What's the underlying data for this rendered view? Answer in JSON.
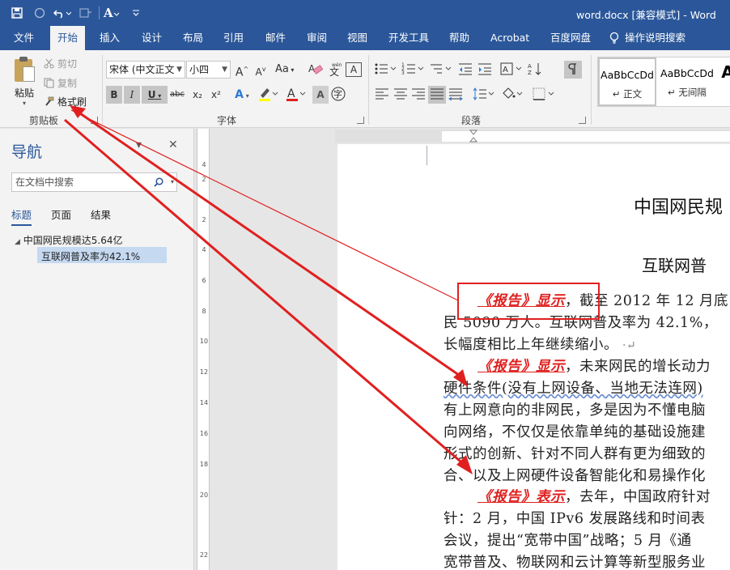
{
  "window": {
    "title": "word.docx [兼容模式] - Word"
  },
  "quick_access": {
    "icons": [
      "save-icon",
      "autosave-icon",
      "undo-icon",
      "redo-icon",
      "font-icon",
      "customize-icon"
    ]
  },
  "tabs": [
    {
      "label": "文件"
    },
    {
      "label": "开始"
    },
    {
      "label": "插入"
    },
    {
      "label": "设计"
    },
    {
      "label": "布局"
    },
    {
      "label": "引用"
    },
    {
      "label": "邮件"
    },
    {
      "label": "审阅"
    },
    {
      "label": "视图"
    },
    {
      "label": "开发工具"
    },
    {
      "label": "帮助"
    },
    {
      "label": "Acrobat"
    },
    {
      "label": "百度网盘"
    }
  ],
  "tell_me": "操作说明搜索",
  "clipboard": {
    "group_label": "剪贴板",
    "paste": "粘贴",
    "cut": "剪切",
    "copy": "复制",
    "format_painter": "格式刷"
  },
  "font": {
    "group_label": "字体",
    "font_name": "宋体 (中文正文)",
    "font_size": "小四",
    "grow": "A",
    "shrink": "A",
    "change_case": "Aa",
    "bold": "B",
    "italic": "I",
    "underline": "U",
    "strike": "abc",
    "subscript": "x₂",
    "superscript": "x²",
    "font_color_a": "A",
    "char_shading_a": "A",
    "wen": "A",
    "circle_char": "字"
  },
  "paragraph": {
    "group_label": "段落"
  },
  "styles": {
    "items": [
      {
        "sample": "AaBbCcDd",
        "name": "正文"
      },
      {
        "sample": "AaBbCcDd",
        "name": "无间隔"
      },
      {
        "sample": "A",
        "name": ""
      }
    ]
  },
  "navigation": {
    "title": "导航",
    "search_placeholder": "在文档中搜索",
    "tabs": [
      {
        "label": "标题"
      },
      {
        "label": "页面"
      },
      {
        "label": "结果"
      }
    ],
    "tree": [
      {
        "label": "中国网民规模达5.64亿"
      },
      {
        "label": "互联网普及率为42.1%"
      }
    ]
  },
  "ruler": {
    "v_numbers": [
      "4",
      "2",
      "2",
      "4",
      "6",
      "8",
      "10",
      "12",
      "14",
      "16",
      "18",
      "20",
      "22"
    ]
  },
  "document": {
    "heading1": "中国网民规",
    "heading2": "互联网普",
    "para1": {
      "report": "《报告》显示",
      "line1_rest": "，截至 2012 年 12 月底",
      "line2": "民 5090 万人。互联网普及率为 42.1%，",
      "line3": "长幅度相比上年继续缩小。"
    },
    "para2": {
      "report": "《报告》显示",
      "line1_rest": "，未来网民的增长动力",
      "line2": "硬件条件(没有上网设备、当地无法连网)",
      "line3": "有上网意向的非网民，多是因为不懂电脑",
      "line4": "向网络，不仅仅是依靠单纯的基础设施建",
      "line5": "形式的创新、针对不同人群有更为细致的",
      "line6": "合、以及上网硬件设备智能化和易操作化"
    },
    "para3": {
      "report": "《报告》表示",
      "line1_rest": "，去年，中国政府针对",
      "line2": "针：2 月，中国 IPv6 发展路线和时间表",
      "line3": "会议，提出“宽带中国”战略；5 月《通",
      "line4": "宽带普及、物联网和云计算等新型服务业"
    }
  },
  "colors": {
    "accent": "#2b579a",
    "annotation": "#e02020"
  }
}
